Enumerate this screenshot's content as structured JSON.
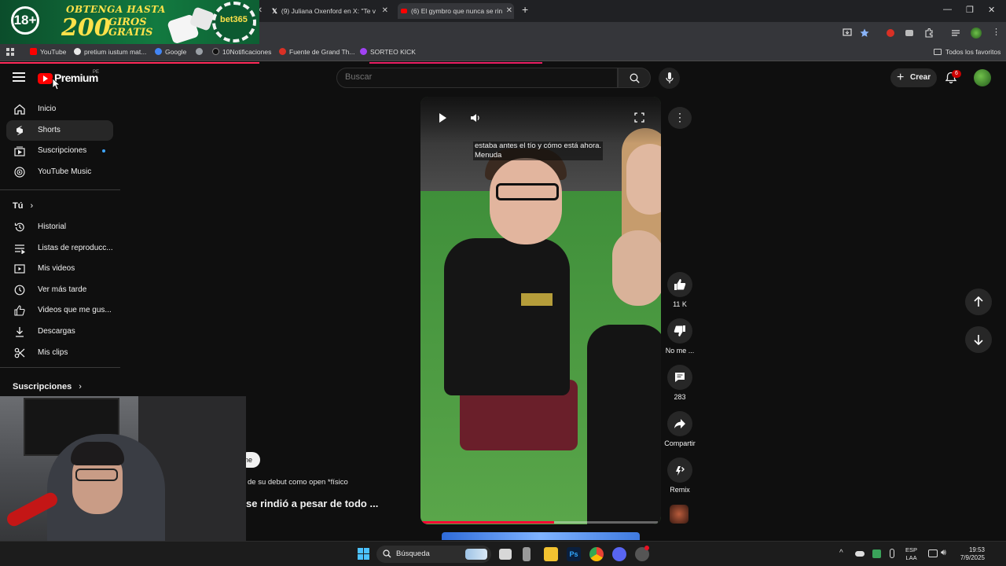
{
  "browser": {
    "ad": {
      "age_badge": "18+",
      "line1": "OBTENGA HASTA",
      "amount": "200",
      "line3a": "GIROS",
      "line3b": "GRATIS",
      "brand": "bet365"
    },
    "tabs": [
      {
        "title": "(9) Juliana Oxenford en X: \"Te v"
      },
      {
        "title": "(6) El gymbro que nunca se rin"
      }
    ],
    "new_tab": "+",
    "window_controls": [
      "—",
      "❐",
      "✕"
    ],
    "bookmarks": [
      {
        "label": "YouTube",
        "color": "#ff0000"
      },
      {
        "label": "pretium iustum mat...",
        "color": "#e8e8e8"
      },
      {
        "label": "Google",
        "color": "#4285f4"
      },
      {
        "label": "",
        "color": "#9aa0a6"
      },
      {
        "label": "10Notificaciones",
        "color": "#111111"
      },
      {
        "label": "Fuente de Grand Th...",
        "color": "#d93025"
      },
      {
        "label": "SORTEO KICK",
        "color": "#a142f4"
      }
    ],
    "all_bookmarks": "Todos los favoritos"
  },
  "header": {
    "logo_text": "Premium",
    "country": "PE",
    "search_placeholder": "Buscar",
    "create_label": "Crear",
    "notification_count": "6"
  },
  "sidebar": {
    "primary": [
      {
        "label": "Inicio",
        "icon": "home-icon"
      },
      {
        "label": "Shorts",
        "icon": "shorts-icon",
        "active": true
      },
      {
        "label": "Suscripciones",
        "icon": "subscriptions-icon",
        "dot": true
      },
      {
        "label": "YouTube Music",
        "icon": "music-icon"
      }
    ],
    "you_title": "Tú",
    "you_items": [
      {
        "label": "Historial",
        "icon": "history-icon"
      },
      {
        "label": "Listas de reproducc...",
        "icon": "playlist-icon"
      },
      {
        "label": "Mis videos",
        "icon": "my-videos-icon"
      },
      {
        "label": "Ver más tarde",
        "icon": "watch-later-icon"
      },
      {
        "label": "Videos que me gus...",
        "icon": "liked-icon"
      },
      {
        "label": "Descargas",
        "icon": "download-icon"
      },
      {
        "label": "Mis clips",
        "icon": "clips-icon"
      }
    ],
    "subs_title": "Suscripciones"
  },
  "short": {
    "caption": "estaba antes el tío y cómo está ahora.\nMenuda",
    "progress": 0.56,
    "pill_text": "ne",
    "description": "de su debut como open *físico",
    "title": "se rindió a pesar de todo ..."
  },
  "actions": {
    "likes": "11 K",
    "dislike_label": "No me ...",
    "comments": "283",
    "share_label": "Compartir",
    "remix_label": "Remix"
  },
  "taskbar": {
    "search_label": "Búsqueda",
    "lang_line1": "ESP",
    "lang_line2": "LAA",
    "time": "19:53",
    "date": "7/9/2025"
  }
}
